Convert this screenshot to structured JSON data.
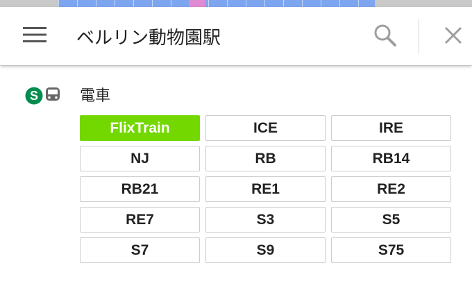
{
  "search": {
    "value": "ベルリン動物園駅",
    "icons": {
      "menu": "hamburger-menu-icon",
      "search": "search-icon",
      "close": "close-icon"
    }
  },
  "transit": {
    "title": "電車",
    "icons": [
      "s-bahn-icon",
      "train-icon"
    ],
    "s_bahn_color": "#008d4f",
    "train_icon_color": "#666666",
    "lines": [
      {
        "label": "FlixTrain",
        "color": "#73d700",
        "highlight": true
      },
      {
        "label": "ICE"
      },
      {
        "label": "IRE"
      },
      {
        "label": "NJ"
      },
      {
        "label": "RB"
      },
      {
        "label": "RB14"
      },
      {
        "label": "RB21"
      },
      {
        "label": "RE1"
      },
      {
        "label": "RE2"
      },
      {
        "label": "RE7"
      },
      {
        "label": "S3"
      },
      {
        "label": "S5"
      },
      {
        "label": "S7"
      },
      {
        "label": "S9"
      },
      {
        "label": "S75"
      }
    ]
  },
  "colors": {
    "map_gray": "#c9c9c9",
    "map_blue": "#7ea6f0",
    "map_pink": "#e08ad1",
    "chip_border": "#cccccc"
  }
}
